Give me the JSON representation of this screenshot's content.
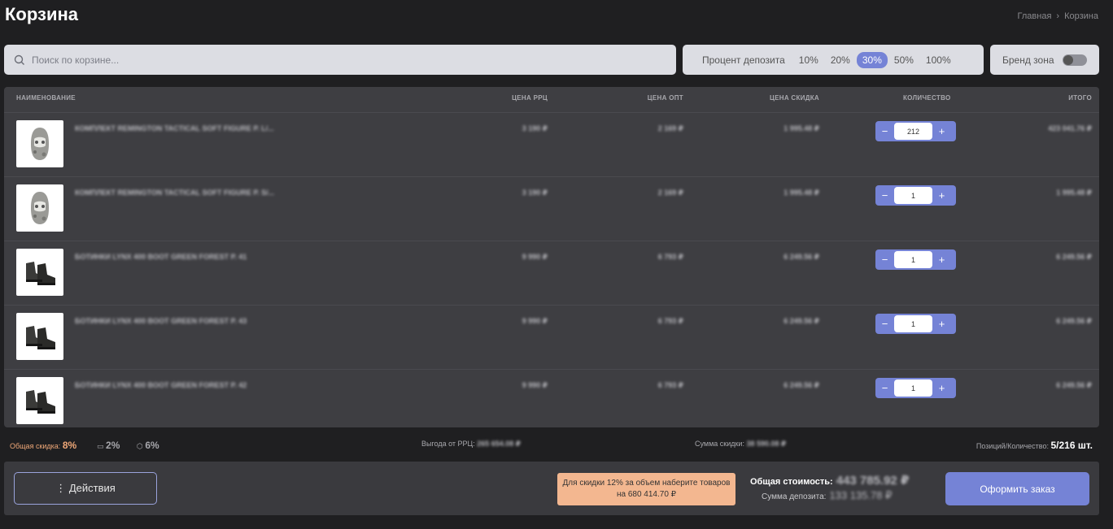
{
  "header": {
    "title": "Корзина",
    "breadcrumb": [
      "Главная",
      "Корзина"
    ]
  },
  "search": {
    "placeholder": "Поиск по корзине...",
    "value": ""
  },
  "deposit": {
    "label": "Процент депозита",
    "options": [
      "10%",
      "20%",
      "30%",
      "50%",
      "100%"
    ],
    "selected": "30%"
  },
  "brand_zone": {
    "label": "Бренд зона",
    "enabled": false
  },
  "table": {
    "columns": [
      "НАИМЕНОВАНИЕ",
      "ЦЕНА РРЦ",
      "ЦЕНА ОПТ",
      "ЦЕНА СКИДКА",
      "КОЛИЧЕСТВО",
      "ИТОГО"
    ],
    "rows": [
      {
        "name": "КОМПЛЕКТ REMINGTON TACTICAL SOFT FIGURE Р. L/...",
        "rrc": "3 190 ₽",
        "opt": "2 169 ₽",
        "discount": "1 995.48 ₽",
        "qty": "212",
        "total": "423 041.76 ₽",
        "image": "balaclava-icon"
      },
      {
        "name": "КОМПЛЕКТ REMINGTON TACTICAL SOFT FIGURE Р. S/...",
        "rrc": "3 190 ₽",
        "opt": "2 169 ₽",
        "discount": "1 995.48 ₽",
        "qty": "1",
        "total": "1 995.48 ₽",
        "image": "balaclava-icon"
      },
      {
        "name": "БОТИНКИ LYNX 400 BOOT GREEN FOREST Р. 41",
        "rrc": "9 990 ₽",
        "opt": "6 793 ₽",
        "discount": "6 249.56 ₽",
        "qty": "1",
        "total": "6 249.56 ₽",
        "image": "boots-icon"
      },
      {
        "name": "БОТИНКИ LYNX 400 BOOT GREEN FOREST Р. 43",
        "rrc": "9 990 ₽",
        "opt": "6 793 ₽",
        "discount": "6 249.56 ₽",
        "qty": "1",
        "total": "6 249.56 ₽",
        "image": "boots-icon"
      },
      {
        "name": "БОТИНКИ LYNX 400 BOOT GREEN FOREST Р. 42",
        "rrc": "9 990 ₽",
        "opt": "6 793 ₽",
        "discount": "6 249.56 ₽",
        "qty": "1",
        "total": "6 249.56 ₽",
        "image": "boots-icon"
      }
    ]
  },
  "summary": {
    "total_discount_label": "Общая скидка:",
    "total_discount": "8%",
    "card_discount": "2%",
    "box_discount": "6%",
    "rrc_benefit_label": "Выгода от РРЦ:",
    "rrc_benefit": "265 654.08 ₽",
    "discount_sum_label": "Сумма скидки:",
    "discount_sum": "38 590.08 ₽",
    "positions_label": "Позиций/Количество:",
    "positions": "5/216 шт."
  },
  "footer": {
    "actions_label": "⋮ Действия",
    "hint": "Для скидки 12% за объем наберите товаров на 680 414.70 ₽",
    "total_label": "Общая стоимость:",
    "total_value": "443 785.92 ₽",
    "deposit_label": "Сумма депозита:",
    "deposit_value": "133 135.78 ₽",
    "checkout_label": "Оформить заказ"
  },
  "colors": {
    "accent": "#7583d6",
    "hint_bg": "#f3b790",
    "discount_text": "#f0a878"
  }
}
